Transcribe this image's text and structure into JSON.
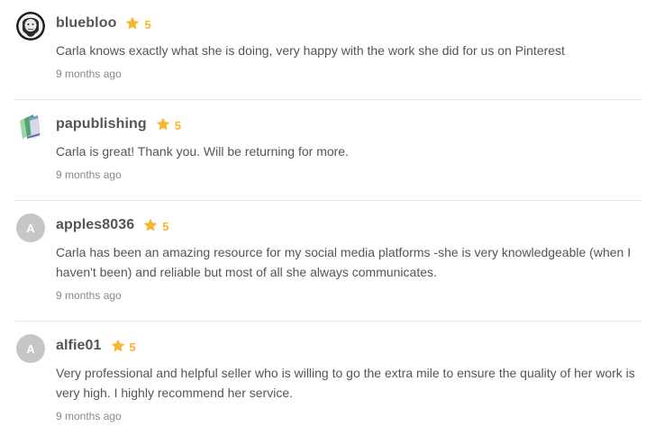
{
  "reviews": [
    {
      "username": "bluebloo",
      "rating": "5",
      "text": "Carla knows exactly what she is doing, very happy with the work she did for us on Pinterest",
      "time": "9 months ago"
    },
    {
      "username": "papublishing",
      "rating": "5",
      "text": "Carla is great! Thank you. Will be returning for more.",
      "time": "9 months ago"
    },
    {
      "username": "apples8036",
      "avatar_letter": "A",
      "rating": "5",
      "text": "Carla has been an amazing resource for my social media platforms -she is very knowledgeable (when I haven't been) and reliable but most of all she always communicates.",
      "time": "9 months ago"
    },
    {
      "username": "alfie01",
      "avatar_letter": "A",
      "rating": "5",
      "text": "Very professional and helpful seller who is willing to go the extra mile to ensure the quality of her work is very high. I highly recommend her service.",
      "time": "9 months ago"
    }
  ],
  "colors": {
    "star": "#f7b52b",
    "username": "#555555",
    "text": "#555555",
    "time": "#888888",
    "divider": "#e4e5e7",
    "letter_avatar_bg": "#c6c6c6"
  },
  "icons": {
    "rating": "star-icon"
  }
}
